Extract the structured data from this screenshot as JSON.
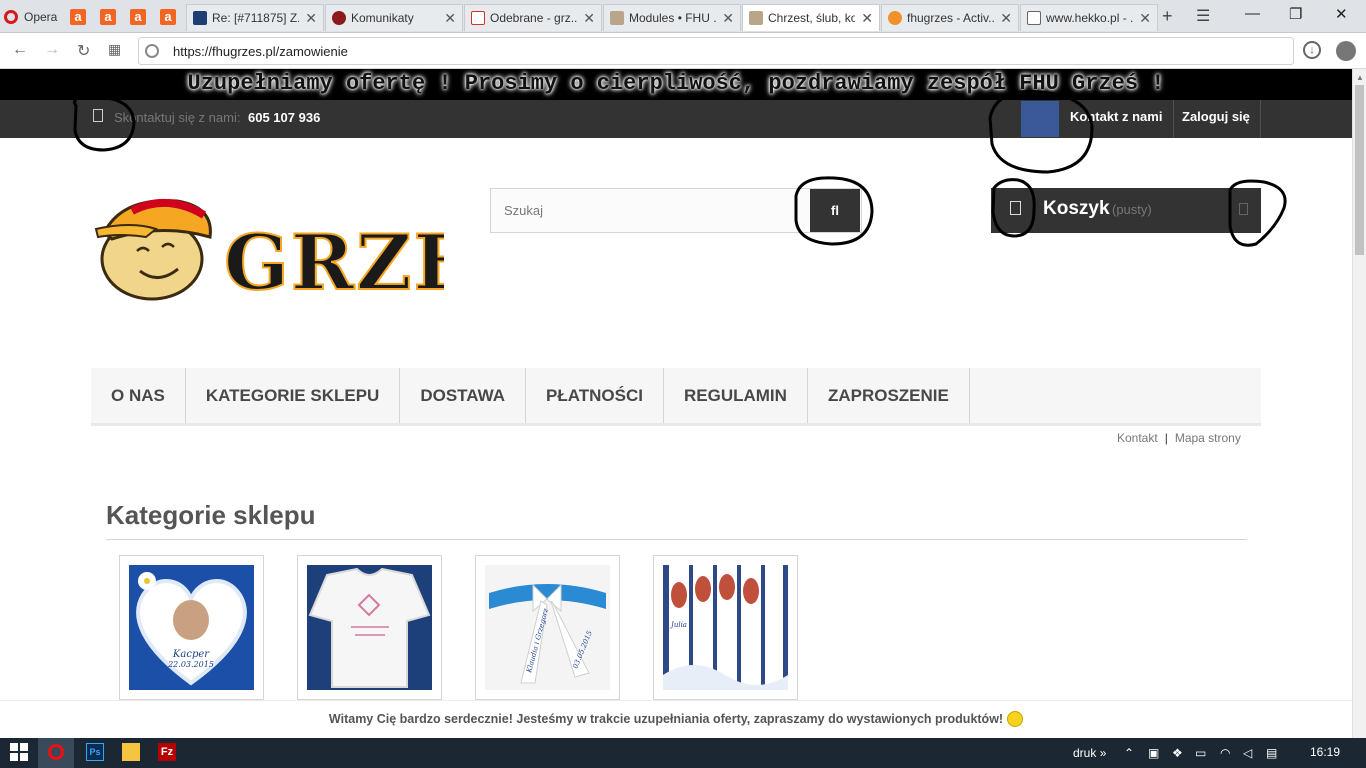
{
  "browser": {
    "opera_label": "Opera",
    "tabs": [
      {
        "title": "Re: [#711875] Z...",
        "favicon": "int-favicon"
      },
      {
        "title": "Komunikaty",
        "favicon": "lock-favicon"
      },
      {
        "title": "Odebrane - grz...",
        "favicon": "gmail-favicon"
      },
      {
        "title": "Modules • FHU ...",
        "favicon": "prestashop-favicon"
      },
      {
        "title": "Chrzest, ślub, ko...",
        "favicon": "prestashop-favicon"
      },
      {
        "title": "fhugrzes - Activ...",
        "favicon": "fire-favicon"
      },
      {
        "title": "www.hekko.pl - ...",
        "favicon": "page-favicon"
      }
    ],
    "url": "https://fhugrzes.pl/zamowienie"
  },
  "banner": {
    "text": "Uzupełniamy ofertę ! Prosimy o cierpliwość, pozdrawiamy zespół FHU Grześ !"
  },
  "topnav": {
    "contact_label": "Skontaktuj się z nami:",
    "phone": "605 107 936",
    "kontakt_link": "Kontakt z nami",
    "login_link": "Zaloguj się"
  },
  "logo": {
    "text": "GRZEŚ"
  },
  "search": {
    "placeholder": "Szukaj",
    "button_label": "fl"
  },
  "cart": {
    "title": "Koszyk",
    "status": "(pusty)"
  },
  "menu": [
    "O NAS",
    "KATEGORIE SKLEPU",
    "DOSTAWA",
    "PŁATNOŚCI",
    "REGULAMIN",
    "ZAPROSZENIE"
  ],
  "sub_links": {
    "kontakt": "Kontakt",
    "sep": "|",
    "sitemap": "Mapa strony"
  },
  "categories": {
    "heading": "Kategorie sklepu",
    "items": [
      {
        "image": "heart-pillow",
        "photo_name": "Kacper",
        "photo_date": "22.03.2015"
      },
      {
        "image": "christening-shirt"
      },
      {
        "image": "wedding-garter",
        "photo_name": "Klaudia i Grzegorz",
        "photo_date": "03.05.2015"
      },
      {
        "image": "christening-candles",
        "photo_name": "Julia"
      }
    ]
  },
  "welcome": {
    "text": "Witamy Cię bardzo serdecznie! Jesteśmy w trakcie uzupełniania oferty, zapraszamy do wystawionych produktów!"
  },
  "taskbar": {
    "tray_label": "druk",
    "tray_chevron": "»",
    "clock": "16:19"
  },
  "colors": {
    "dark_bar": "#333333",
    "facebook": "#3b5998",
    "accent_orange": "#f26522"
  }
}
